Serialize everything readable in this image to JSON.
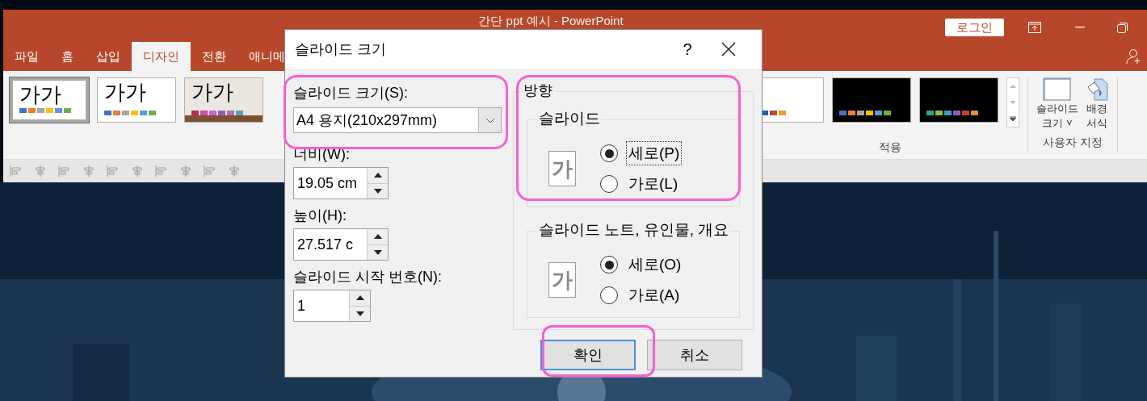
{
  "window": {
    "title": "간단 ppt 예시  -  PowerPoint",
    "account_button": "로그인"
  },
  "tabs": [
    {
      "label": "파일",
      "selected": false
    },
    {
      "label": "홈",
      "selected": false
    },
    {
      "label": "삽입",
      "selected": false
    },
    {
      "label": "디자인",
      "selected": true
    },
    {
      "label": "전환",
      "selected": false
    },
    {
      "label": "애니메",
      "selected": false
    }
  ],
  "themes_left": [
    {
      "label": "가가",
      "kind": "white",
      "selected": true
    },
    {
      "label": "가가",
      "kind": "white",
      "selected": false
    },
    {
      "label": "가가",
      "kind": "beige",
      "selected": false
    }
  ],
  "themes_right": [
    {
      "kind": "white",
      "selected": false
    },
    {
      "kind": "black",
      "selected": false
    },
    {
      "kind": "black2",
      "selected": false
    }
  ],
  "groups": [
    {
      "label": "적용"
    },
    {
      "label": "사용자 지정"
    }
  ],
  "ribbon_buttons": [
    {
      "label_lines": [
        "슬라이드",
        "크기 ˅"
      ],
      "kind": "slide-size"
    },
    {
      "label_lines": [
        "배경",
        "서식"
      ],
      "kind": "background"
    }
  ],
  "dialog": {
    "title": "슬라이드 크기",
    "help": "?",
    "size_label": "슬라이드 크기(S):",
    "size_value": "A4 용지(210x297mm)",
    "width_label": "너비(W):",
    "width_value": "19.05 cm",
    "height_label": "높이(H):",
    "height_value": "27.517 c",
    "start_label": "슬라이드 시작 번호(N):",
    "start_value": "1",
    "orientation_label": "방향",
    "orientation_groups": [
      {
        "label": "슬라이드",
        "glyph": "가",
        "options": [
          {
            "label": "세로(P)",
            "selected": true,
            "focused": true
          },
          {
            "label": "가로(L)",
            "selected": false,
            "focused": false
          }
        ]
      },
      {
        "label": "슬라이드 노트, 유인물, 개요",
        "glyph": "가",
        "options": [
          {
            "label": "세로(O)",
            "selected": true,
            "focused": false
          },
          {
            "label": "가로(A)",
            "selected": false,
            "focused": false
          }
        ]
      }
    ],
    "buttons": [
      {
        "label": "확인",
        "focused": true
      },
      {
        "label": "취소",
        "focused": false
      }
    ]
  }
}
